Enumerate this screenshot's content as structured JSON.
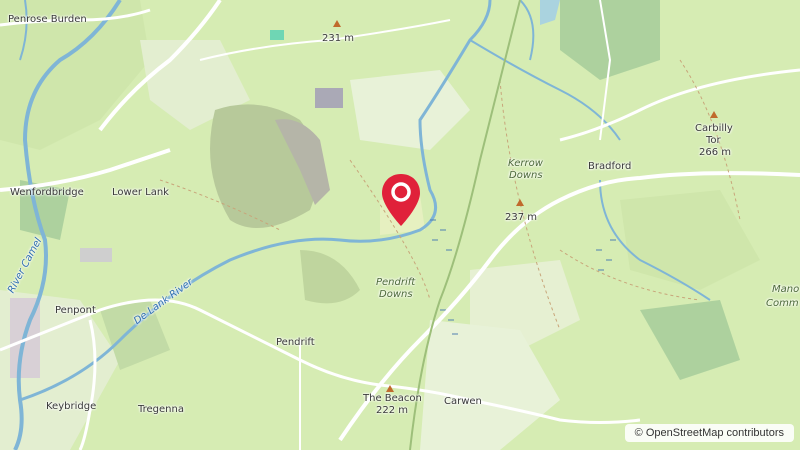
{
  "places": {
    "penrose_burden": "Penrose Burden",
    "wenfordbridge": "Wenfordbridge",
    "lower_lank": "Lower Lank",
    "penpont": "Penpont",
    "keybridge": "Keybridge",
    "tregenna": "Tregenna",
    "pendrift": "Pendrift",
    "carwen": "Carwen",
    "bradford": "Bradford"
  },
  "areas": {
    "kerrow_downs_1": "Kerrow",
    "kerrow_downs_2": "Downs",
    "pendrift_downs_1": "Pendrift",
    "pendrift_downs_2": "Downs",
    "manor_common_1": "Mano",
    "manor_common_2": "Comm"
  },
  "rivers": {
    "camel": "River Camel",
    "de_lank": "De Lank River"
  },
  "peaks": {
    "p231": "231 m",
    "p237": "237 m",
    "carbilly_1": "Carbilly",
    "carbilly_2": "Tor",
    "carbilly_3": "266 m",
    "beacon_1": "The Beacon",
    "beacon_2": "222 m"
  },
  "attribution": "© OpenStreetMap contributors",
  "colors": {
    "land": "#d6ecb3",
    "field": "#cde5a8",
    "wood": "#add19e",
    "water": "#aad3df",
    "river": "#7fb5d6",
    "road": "#ffffff",
    "marker": "#e0213a"
  }
}
